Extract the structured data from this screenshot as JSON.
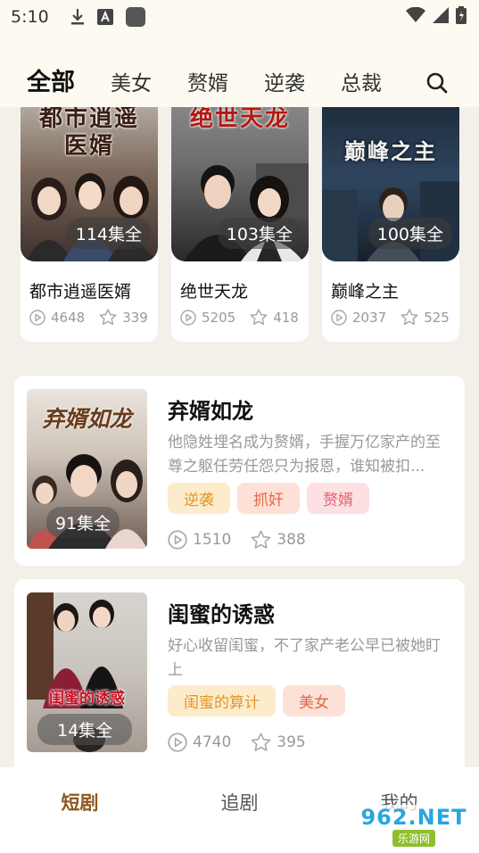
{
  "status_bar": {
    "time": "5:10"
  },
  "top_tabs": [
    "全部",
    "美女",
    "赘婿",
    "逆袭",
    "总裁"
  ],
  "grid_cards": [
    {
      "title": "都市逍遥医婿",
      "cover_text": "都市逍遥\n医婿",
      "episodes": "114集全",
      "plays": "4648",
      "likes": "339"
    },
    {
      "title": "绝世天龙",
      "cover_text": "绝世天龙",
      "episodes": "103集全",
      "plays": "5205",
      "likes": "418"
    },
    {
      "title": "巅峰之主",
      "cover_text": "巅峰之主",
      "episodes": "100集全",
      "plays": "2037",
      "likes": "525"
    }
  ],
  "list_cards": [
    {
      "title": "弃婿如龙",
      "cover_text": "弃婿如龙",
      "episodes": "91集全",
      "description": "他隐姓埋名成为赘婿，手握万亿家产的至尊之躯任劳任怨只为报恩，谁知被扣...",
      "tags": [
        "逆袭",
        "抓奸",
        "赘婿"
      ],
      "plays": "1510",
      "likes": "388"
    },
    {
      "title": "闺蜜的诱惑",
      "cover_text": "闺蜜的诱惑",
      "episodes": "14集全",
      "description": "好心收留闺蜜，不了家产老公早已被她盯上",
      "tags": [
        "闺蜜的算计",
        "美女"
      ],
      "plays": "4740",
      "likes": "395"
    }
  ],
  "bottom_nav": [
    "短剧",
    "追剧",
    "我的"
  ],
  "watermark": {
    "line1": "962.NET",
    "line2": "乐游网"
  },
  "colors": {
    "active_nav": "#8c5a1c",
    "background": "#f3f0ea",
    "header": "#fdfbf1"
  }
}
